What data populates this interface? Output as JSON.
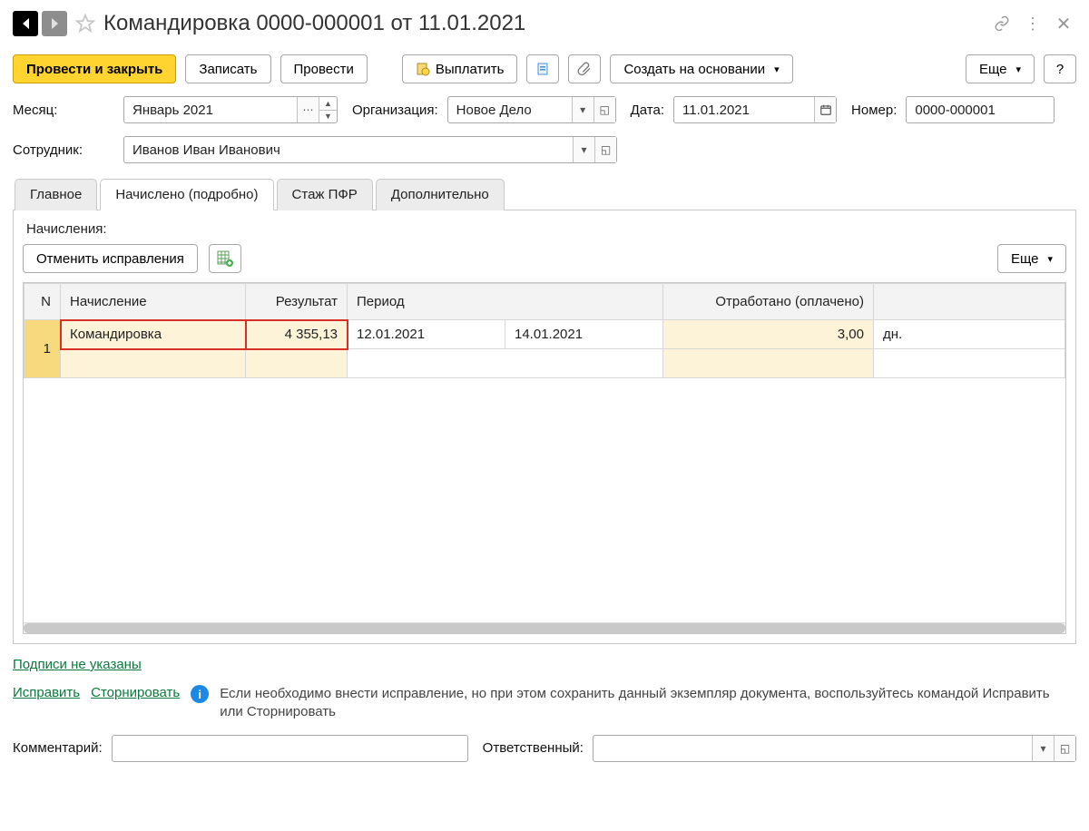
{
  "title": "Командировка 0000-000001 от 11.01.2021",
  "toolbar": {
    "post_close": "Провести и закрыть",
    "write": "Записать",
    "post": "Провести",
    "payout": "Выплатить",
    "create_based": "Создать на основании",
    "more": "Еще",
    "help": "?"
  },
  "fields": {
    "month_label": "Месяц:",
    "month_value": "Январь 2021",
    "org_label": "Организация:",
    "org_value": "Новое Дело",
    "date_label": "Дата:",
    "date_value": "11.01.2021",
    "number_label": "Номер:",
    "number_value": "0000-000001",
    "employee_label": "Сотрудник:",
    "employee_value": "Иванов Иван Иванович"
  },
  "tabs": {
    "main": "Главное",
    "accrued": "Начислено (подробно)",
    "pfr": "Стаж ПФР",
    "extra": "Дополнительно"
  },
  "sub": {
    "header": "Начисления:",
    "cancel_corrections": "Отменить исправления",
    "more": "Еще"
  },
  "table": {
    "headers": {
      "n": "N",
      "name": "Начисление",
      "result": "Результат",
      "period": "Период",
      "worked": "Отработано (оплачено)"
    },
    "row": {
      "n": "1",
      "name": "Командировка",
      "result": "4 355,13",
      "period_from": "12.01.2021",
      "period_to": "14.01.2021",
      "worked": "3,00",
      "unit": "дн."
    }
  },
  "footer": {
    "signatures": "Подписи не указаны",
    "correct": "Исправить",
    "storno": "Сторнировать",
    "info": "Если необходимо внести исправление, но при этом сохранить данный экземпляр документа, воспользуйтесь командой Исправить или Сторнировать",
    "comment_label": "Комментарий:",
    "responsible_label": "Ответственный:"
  }
}
